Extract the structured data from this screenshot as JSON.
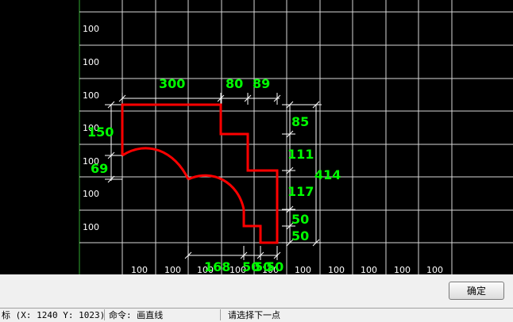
{
  "canvas": {
    "grid_label": "100",
    "grid_color": "#d8d8d8",
    "shape_color": "#ff0000",
    "dim_color": "#00ff00",
    "dimension_labels": [
      "300",
      "80",
      "89",
      "150",
      "69",
      "85",
      "111",
      "117",
      "414",
      "50",
      "50",
      "168",
      "50",
      "50",
      "50"
    ]
  },
  "dialog": {
    "ok_label": "确定"
  },
  "status": {
    "coords": "标 (X: 1240 Y: 1023)",
    "command": "命令: 画直线",
    "prompt": "请选择下一点"
  }
}
